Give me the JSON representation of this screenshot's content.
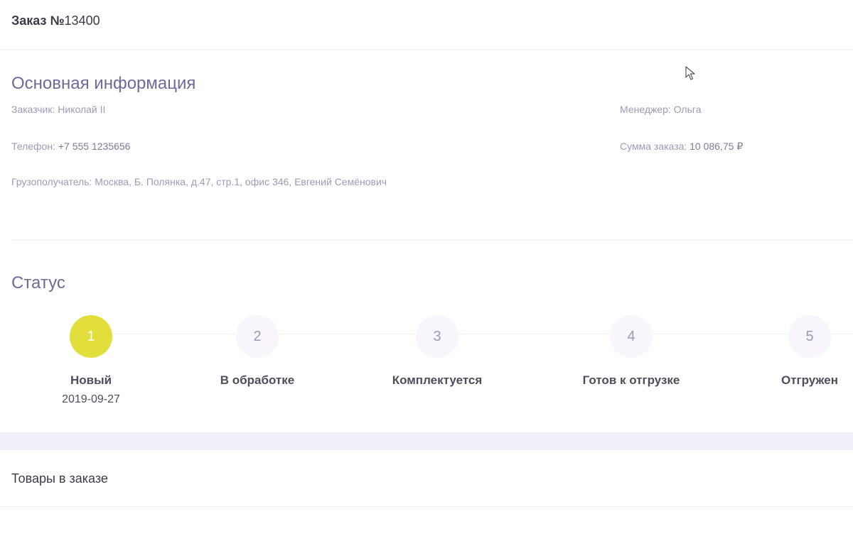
{
  "header": {
    "order_label": "Заказ №",
    "order_number": "13400"
  },
  "info": {
    "section_title": "Основная информация",
    "customer_label": "Заказчик:",
    "customer_value": "Николай II",
    "phone_label": "Телефон:",
    "phone_value": "+7 555 1235656",
    "consignee_label": "Грузополучатель:",
    "consignee_value": "Москва, Б. Полянка, д.47, стр.1, офис 346, Евгений Семёнович",
    "manager_label": "Менеджер:",
    "manager_value": "Ольга",
    "total_label": "Сумма заказа:",
    "total_value": "10 086,75 ₽"
  },
  "status": {
    "section_title": "Статус",
    "steps": [
      {
        "number": "1",
        "label": "Новый",
        "date": "2019-09-27",
        "active": true
      },
      {
        "number": "2",
        "label": "В обработке",
        "date": "",
        "active": false
      },
      {
        "number": "3",
        "label": "Комплектуется",
        "date": "",
        "active": false
      },
      {
        "number": "4",
        "label": "Готов к отгрузке",
        "date": "",
        "active": false
      },
      {
        "number": "5",
        "label": "Отгружен",
        "date": "",
        "active": false
      }
    ],
    "active_color": "#e2df3c"
  },
  "products": {
    "title": "Товары в заказе"
  },
  "icons": {
    "cursor": "mouse-pointer-icon"
  }
}
